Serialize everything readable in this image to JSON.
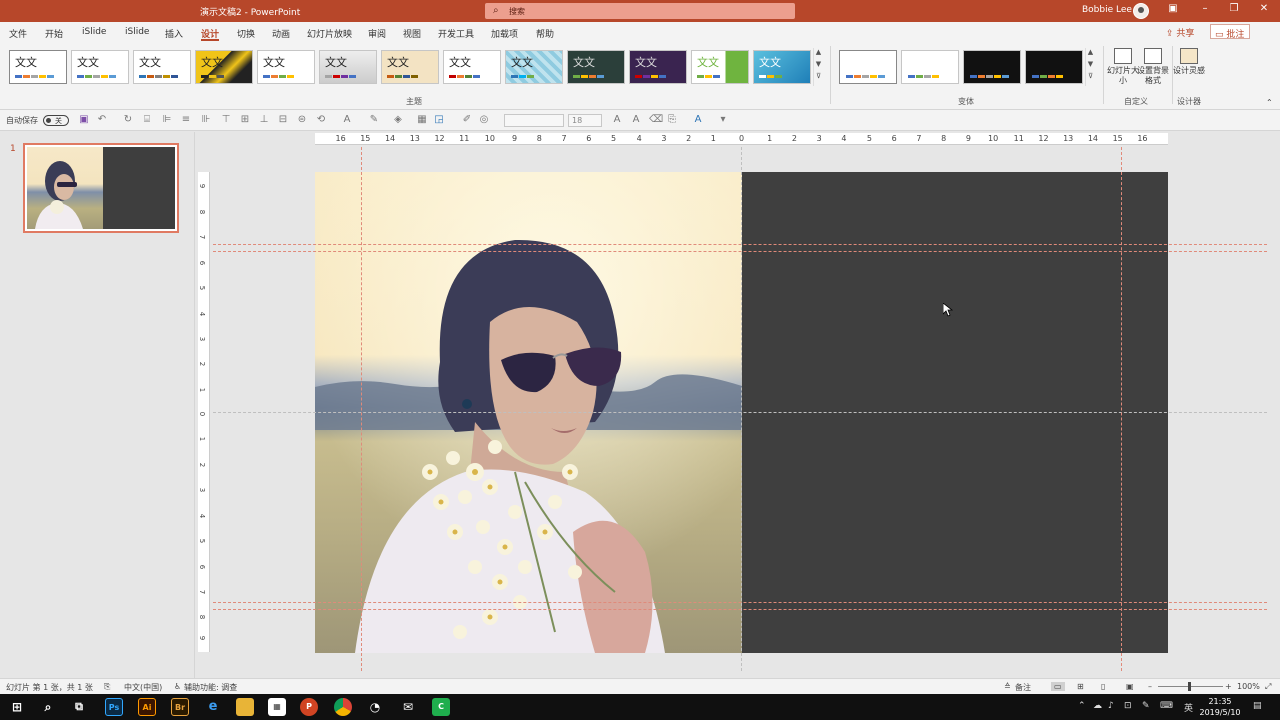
{
  "titlebar": {
    "doc_title": "演示文稿2  -  PowerPoint",
    "search_placeholder": "搜索",
    "user_name": "Bobbie Lee"
  },
  "menu": {
    "tabs": [
      "文件",
      "开始",
      "iSlide",
      "iSlide",
      "插入",
      "设计",
      "切换",
      "动画",
      "幻灯片放映",
      "审阅",
      "视图",
      "开发工具",
      "加载项",
      "帮助"
    ],
    "active_tab": "设计",
    "share_label": "共享",
    "comment_label": "批注"
  },
  "ribbon": {
    "theme_sample_text": "文文",
    "themes_group_label": "主题",
    "variants_group_label": "变体",
    "customize_group_label": "自定义",
    "designer_group_label": "设计器",
    "slide_size_label": "幻灯片大小",
    "format_bg_label": "设置背景格式",
    "design_ideas_label": "设计灵感"
  },
  "qat": {
    "autosave_label": "自动保存",
    "autosave_state": "关",
    "font_size": "18"
  },
  "thumbnails": {
    "slide_number": "1"
  },
  "rulers": {
    "h_labels": [
      "16",
      "15",
      "14",
      "13",
      "12",
      "11",
      "10",
      "9",
      "8",
      "7",
      "6",
      "5",
      "4",
      "3",
      "2",
      "1",
      "0",
      "1",
      "2",
      "3",
      "4",
      "5",
      "6",
      "7",
      "8",
      "9",
      "10",
      "11",
      "12",
      "13",
      "14",
      "15",
      "16"
    ],
    "v_labels": [
      "9",
      "8",
      "7",
      "6",
      "5",
      "4",
      "3",
      "2",
      "1",
      "0",
      "1",
      "2",
      "3",
      "4",
      "5",
      "6",
      "7",
      "8",
      "9"
    ]
  },
  "statusbar": {
    "slide_info": "幻灯片 第 1 张，共 1 张",
    "language": "中文(中国)",
    "accessibility": "辅助功能: 调查",
    "notes_label": "备注",
    "zoom": "100%"
  },
  "taskbar": {
    "time": "21:35",
    "date": "2019/5/10",
    "ime": "英"
  },
  "colors": {
    "accent": "#b7472a",
    "slide_dark": "#3f3f3f",
    "guide": "#e08a7a"
  }
}
